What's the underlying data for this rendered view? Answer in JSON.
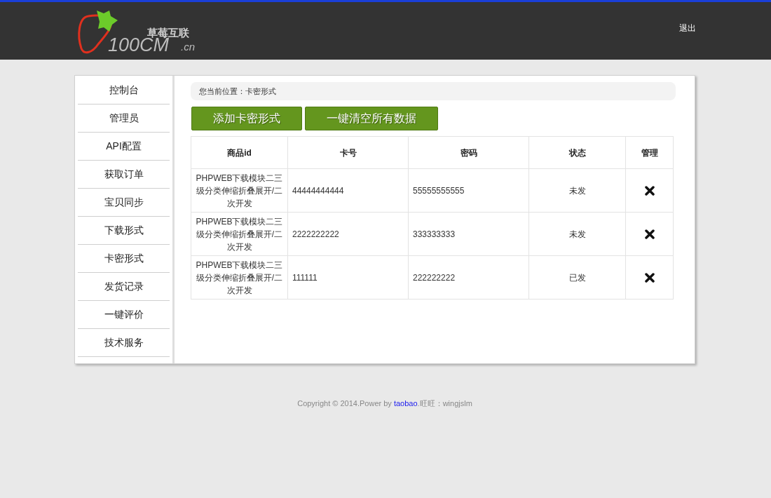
{
  "header": {
    "logo": {
      "brand_cn": "草莓互联",
      "brand_en": "100CM",
      "domain": ".cn"
    },
    "logout": "退出"
  },
  "sidebar": {
    "items": [
      "控制台",
      "管理员",
      "API配置",
      "获取订单",
      "宝贝同步",
      "下载形式",
      "卡密形式",
      "发货记录",
      "一键评价",
      "技术服务"
    ]
  },
  "breadcrumb": "您当前位置：卡密形式",
  "buttons": [
    "添加卡密形式",
    "一键清空所有数据"
  ],
  "table": {
    "columns": [
      "商品id",
      "卡号",
      "密码",
      "状态",
      "管理"
    ],
    "rows": [
      {
        "product": "PHPWEB下载模块二三级分类伸缩折叠展开/二次开发",
        "card_no": "44444444444",
        "password": "55555555555",
        "status": "未发"
      },
      {
        "product": "PHPWEB下载模块二三级分类伸缩折叠展开/二次开发",
        "card_no": "2222222222",
        "password": "333333333",
        "status": "未发"
      },
      {
        "product": "PHPWEB下载模块二三级分类伸缩折叠展开/二次开发",
        "card_no": "111111",
        "password": "222222222",
        "status": "已发"
      }
    ]
  },
  "footer": {
    "prefix": "Copyright © 2014.Power by ",
    "link": "taobao",
    "suffix": ".旺旺：wingjslm"
  }
}
